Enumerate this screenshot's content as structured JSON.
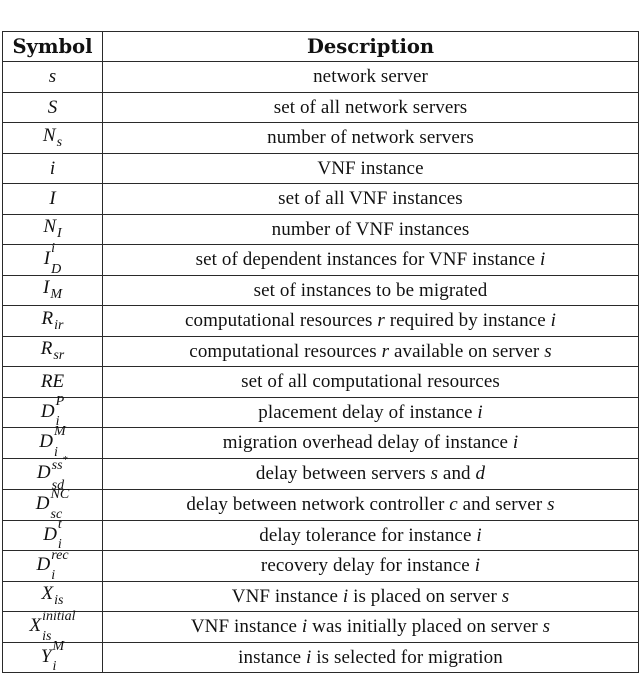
{
  "table": {
    "headers": {
      "symbol": "Symbol",
      "description": "Description"
    },
    "rows": [
      {
        "symbol": {
          "base": "s",
          "sup": "",
          "sub": ""
        },
        "description": [
          {
            "t": "network server"
          }
        ]
      },
      {
        "symbol": {
          "base": "S",
          "sup": "",
          "sub": ""
        },
        "description": [
          {
            "t": "set of all network servers"
          }
        ]
      },
      {
        "symbol": {
          "base": "N",
          "sup": "",
          "sub": "s"
        },
        "description": [
          {
            "t": "number of network servers"
          }
        ]
      },
      {
        "symbol": {
          "base": "i",
          "sup": "",
          "sub": ""
        },
        "description": [
          {
            "t": "VNF instance"
          }
        ]
      },
      {
        "symbol": {
          "base": "I",
          "sup": "",
          "sub": ""
        },
        "description": [
          {
            "t": "set of all VNF instances"
          }
        ]
      },
      {
        "symbol": {
          "base": "N",
          "sup": "",
          "sub": "I"
        },
        "description": [
          {
            "t": "number of VNF instances"
          }
        ]
      },
      {
        "symbol": {
          "base": "I",
          "sup": "i",
          "sub": "D"
        },
        "description": [
          {
            "t": "set of dependent instances for VNF instance "
          },
          {
            "m": "i"
          }
        ]
      },
      {
        "symbol": {
          "base": "I",
          "sup": "",
          "sub": "M"
        },
        "description": [
          {
            "t": "set of instances to be migrated"
          }
        ]
      },
      {
        "symbol": {
          "base": "R",
          "sup": "",
          "sub": "ir"
        },
        "description": [
          {
            "t": "computational resources "
          },
          {
            "m": "r"
          },
          {
            "t": " required by instance "
          },
          {
            "m": "i"
          }
        ]
      },
      {
        "symbol": {
          "base": "R",
          "sup": "",
          "sub": "sr"
        },
        "description": [
          {
            "t": "computational resources "
          },
          {
            "m": "r"
          },
          {
            "t": " available on server "
          },
          {
            "m": "s"
          }
        ]
      },
      {
        "symbol": {
          "base": "RE",
          "sup": "",
          "sub": ""
        },
        "description": [
          {
            "t": "set of all computational resources"
          }
        ]
      },
      {
        "symbol": {
          "base": "D",
          "sup": "P",
          "sub": "i"
        },
        "description": [
          {
            "t": "placement delay of instance "
          },
          {
            "m": "i"
          }
        ]
      },
      {
        "symbol": {
          "base": "D",
          "sup": "M",
          "sub": "i"
        },
        "description": [
          {
            "t": "migration overhead delay of instance "
          },
          {
            "m": "i"
          }
        ]
      },
      {
        "symbol": {
          "base": "D",
          "sup": "ss*",
          "sub": "sd"
        },
        "description": [
          {
            "t": "delay between servers "
          },
          {
            "m": "s"
          },
          {
            "t": " and "
          },
          {
            "m": "d"
          }
        ]
      },
      {
        "symbol": {
          "base": "D",
          "sup": "NC",
          "sub": "sc"
        },
        "description": [
          {
            "t": "delay between network controller "
          },
          {
            "m": "c"
          },
          {
            "t": " and server "
          },
          {
            "m": "s"
          }
        ]
      },
      {
        "symbol": {
          "base": "D",
          "sup": "t",
          "sub": "i"
        },
        "description": [
          {
            "t": "delay tolerance for instance "
          },
          {
            "m": "i"
          }
        ]
      },
      {
        "symbol": {
          "base": "D",
          "sup": "rec",
          "sub": "i"
        },
        "description": [
          {
            "t": "recovery delay for instance "
          },
          {
            "m": "i"
          }
        ]
      },
      {
        "symbol": {
          "base": "X",
          "sup": "",
          "sub": "is"
        },
        "description": [
          {
            "t": "VNF instance "
          },
          {
            "m": "i"
          },
          {
            "t": " is placed on server "
          },
          {
            "m": "s"
          }
        ]
      },
      {
        "symbol": {
          "base": "X",
          "sup": "initial",
          "sub": "is"
        },
        "description": [
          {
            "t": "VNF instance "
          },
          {
            "m": "i"
          },
          {
            "t": " was initially placed on server "
          },
          {
            "m": "s"
          }
        ]
      },
      {
        "symbol": {
          "base": "Y",
          "sup": "M",
          "sub": "i"
        },
        "description": [
          {
            "t": "instance "
          },
          {
            "m": "i"
          },
          {
            "t": " is selected for migration"
          }
        ]
      }
    ]
  }
}
